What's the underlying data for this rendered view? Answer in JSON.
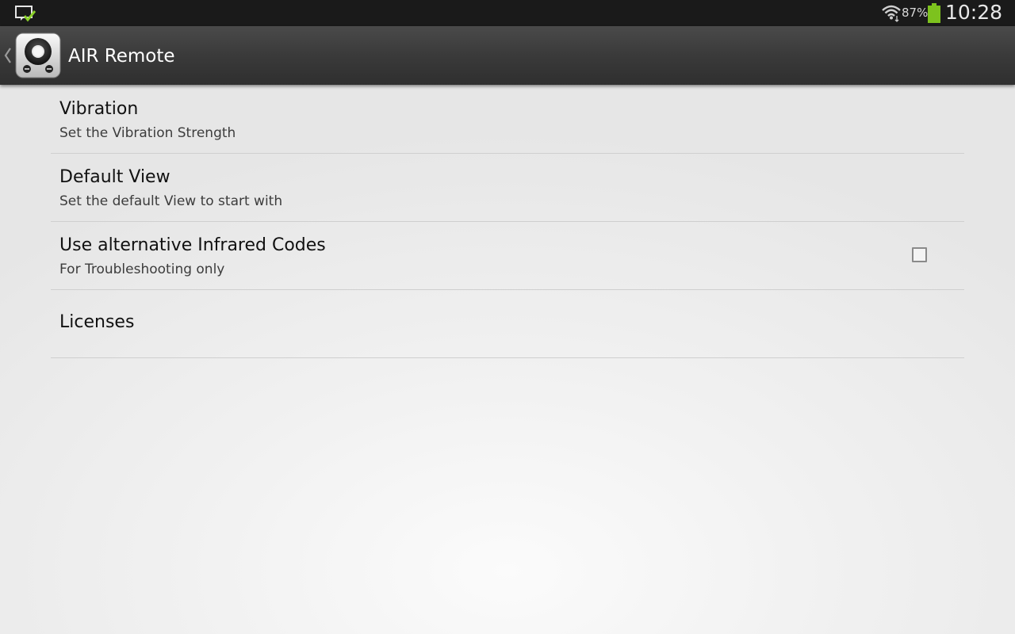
{
  "status_bar": {
    "notification_icon": "screenshot-notification-icon",
    "wifi_icon": "wifi-icon",
    "battery_percent": "87%",
    "battery_icon": "battery-icon",
    "battery_color": "#7dc21e",
    "time": "10:28"
  },
  "action_bar": {
    "back_icon": "chevron-left-icon",
    "app_icon": "remote-app-icon",
    "title": "AIR Remote"
  },
  "preferences": [
    {
      "title": "Vibration",
      "summary": "Set the Vibration Strength"
    },
    {
      "title": "Default View",
      "summary": "Set the default View to start with"
    },
    {
      "title": "Use alternative Infrared Codes",
      "summary": "For Troubleshooting only",
      "checkbox": false
    },
    {
      "title": "Licenses"
    }
  ]
}
